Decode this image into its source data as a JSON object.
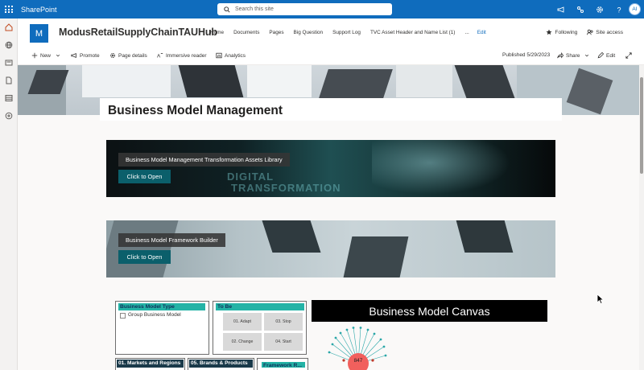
{
  "suitebar": {
    "app_name": "SharePoint",
    "search_placeholder": "Search this site",
    "user_initials": "AI"
  },
  "site": {
    "logo_letter": "M",
    "title": "ModusRetailSupplyChainTAUHub",
    "nav": [
      "Home",
      "Documents",
      "Pages",
      "Big Question",
      "Support Log",
      "TVC Asset Header and Name List (1)",
      "...",
      "Edit"
    ],
    "following_label": "Following",
    "site_access_label": "Site access"
  },
  "commandbar": {
    "new_label": "New",
    "promote_label": "Promote",
    "page_details_label": "Page details",
    "immersive_reader_label": "Immersive reader",
    "analytics_label": "Analytics",
    "published_label": "Published 5/29/2023",
    "share_label": "Share",
    "edit_label": "Edit"
  },
  "page": {
    "title": "Business Model Management",
    "banner1": {
      "label": "Business Model Management Transformation Assets Library",
      "button": "Click to Open",
      "deco": "DIGITAL TRANSFORMATION"
    },
    "banner2": {
      "label": "Business Model Framework Builder",
      "button": "Click to Open"
    }
  },
  "canvas": {
    "business_model_type": {
      "header": "Business Model Type",
      "option": "Group Business Model"
    },
    "to_be": {
      "header": "To Be",
      "cells": [
        "01. Adapt",
        "03. Stop",
        "02. Change",
        "04. Start"
      ]
    },
    "title": "Business Model Canvas",
    "markets_header": "01. Markets and Regions",
    "brands_header": "05. Brands & Products",
    "framework_header": "Framework R...",
    "node_value": "847"
  }
}
